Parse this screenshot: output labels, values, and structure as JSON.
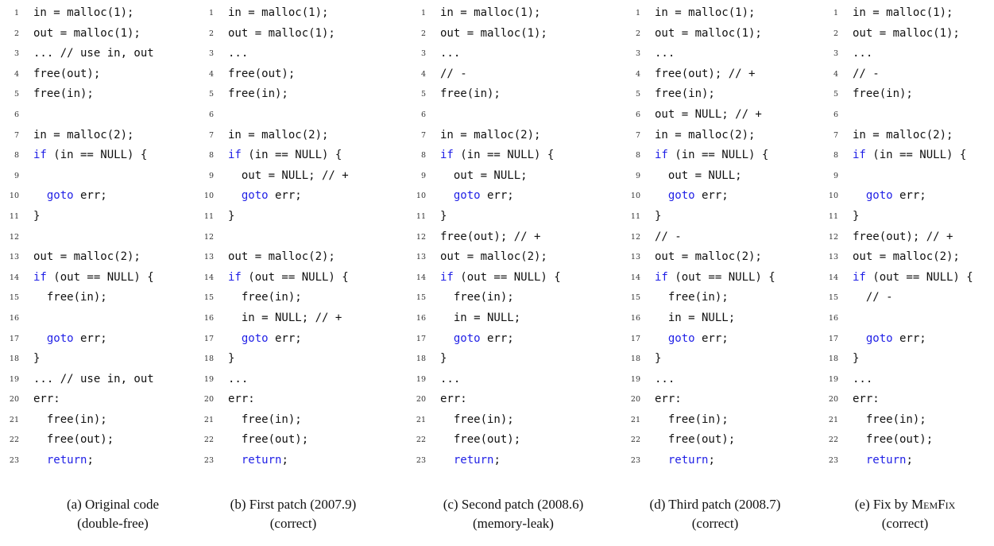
{
  "panels": [
    {
      "caption_line1": "(a) Original code",
      "caption_line2": "(double-free)",
      "lines": [
        "in = malloc(1);",
        "out = malloc(1);",
        "... // use in, out",
        "free(out);",
        "free(in);",
        "",
        "in = malloc(2);",
        "if (in == NULL) {",
        "",
        "  goto err;",
        "}",
        "",
        "out = malloc(2);",
        "if (out == NULL) {",
        "  free(in);",
        "",
        "  goto err;",
        "}",
        "... // use in, out",
        "err:",
        "  free(in);",
        "  free(out);",
        "  return;"
      ]
    },
    {
      "caption_line1": "(b) First patch (2007.9)",
      "caption_line2": "(correct)",
      "lines": [
        "in = malloc(1);",
        "out = malloc(1);",
        "...",
        "free(out);",
        "free(in);",
        "",
        "in = malloc(2);",
        "if (in == NULL) {",
        "  out = NULL; // +",
        "  goto err;",
        "}",
        "",
        "out = malloc(2);",
        "if (out == NULL) {",
        "  free(in);",
        "  in = NULL; // +",
        "  goto err;",
        "}",
        "...",
        "err:",
        "  free(in);",
        "  free(out);",
        "  return;"
      ]
    },
    {
      "caption_line1": "(c) Second patch (2008.6)",
      "caption_line2": "(memory-leak)",
      "lines": [
        "in = malloc(1);",
        "out = malloc(1);",
        "...",
        "// -",
        "free(in);",
        "",
        "in = malloc(2);",
        "if (in == NULL) {",
        "  out = NULL;",
        "  goto err;",
        "}",
        "free(out); // +",
        "out = malloc(2);",
        "if (out == NULL) {",
        "  free(in);",
        "  in = NULL;",
        "  goto err;",
        "}",
        "...",
        "err:",
        "  free(in);",
        "  free(out);",
        "  return;"
      ]
    },
    {
      "caption_line1": "(d) Third patch (2008.7)",
      "caption_line2": "(correct)",
      "lines": [
        "in = malloc(1);",
        "out = malloc(1);",
        "...",
        "free(out); // +",
        "free(in);",
        "out = NULL; // +",
        "in = malloc(2);",
        "if (in == NULL) {",
        "  out = NULL;",
        "  goto err;",
        "}",
        "// -",
        "out = malloc(2);",
        "if (out == NULL) {",
        "  free(in);",
        "  in = NULL;",
        "  goto err;",
        "}",
        "...",
        "err:",
        "  free(in);",
        "  free(out);",
        "  return;"
      ]
    },
    {
      "caption_line1": "(e) Fix by MemFix",
      "caption_prefix": "(e) Fix by ",
      "caption_smallcaps": "MemFix",
      "caption_line2": "(correct)",
      "lines": [
        "in = malloc(1);",
        "out = malloc(1);",
        "...",
        "// -",
        "free(in);",
        "",
        "in = malloc(2);",
        "if (in == NULL) {",
        "",
        "  goto err;",
        "}",
        "free(out); // +",
        "out = malloc(2);",
        "if (out == NULL) {",
        "  // -",
        "",
        "  goto err;",
        "}",
        "...",
        "err:",
        "  free(in);",
        "  free(out);",
        "  return;"
      ]
    }
  ],
  "keywords": [
    "if",
    "goto",
    "return"
  ],
  "keyword_color": "#1f1fe6"
}
